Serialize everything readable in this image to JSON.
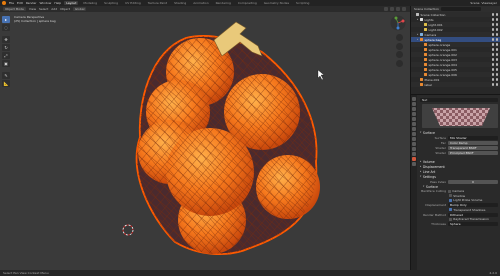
{
  "topbar": {
    "menus": [
      "File",
      "Edit",
      "Render",
      "Window",
      "Help"
    ],
    "workspaces": [
      "Layout",
      "Modeling",
      "Sculpting",
      "UV Editing",
      "Texture Paint",
      "Shading",
      "Animation",
      "Rendering",
      "Compositing",
      "Geometry Nodes",
      "Scripting"
    ],
    "active_workspace": "Layout",
    "scene": "Scene",
    "view_layer": "ViewLayer"
  },
  "viewport_header": {
    "mode": "Object Mode",
    "menus": [
      "View",
      "Select",
      "Add",
      "Object"
    ],
    "transform": "Global"
  },
  "viewport": {
    "view_name": "Camera Perspective",
    "collection": "(25) Collection | sphere bag",
    "tools": [
      "▸",
      "◌",
      "✥",
      "↻",
      "⤢",
      "▣",
      "✎",
      "📐"
    ]
  },
  "outliner": {
    "title": "Scene Collection",
    "rows": [
      {
        "label": "Scene Collection",
        "indent": 0,
        "color": "#bdbdbd",
        "tri": ""
      },
      {
        "label": "Lights",
        "indent": 1,
        "color": "#e0e0e0",
        "tri": "▸"
      },
      {
        "label": "Light.001",
        "indent": 2,
        "color": "#e0c04a",
        "tri": ""
      },
      {
        "label": "Light.002",
        "indent": 2,
        "color": "#e0c04a",
        "tri": ""
      },
      {
        "label": "Camera",
        "indent": 1,
        "color": "#7fb0e0",
        "tri": "▸"
      },
      {
        "label": "sphere bag",
        "indent": 1,
        "color": "#e98a32",
        "tri": "▸",
        "selected": true
      },
      {
        "label": "sphere orange",
        "indent": 2,
        "color": "#e98a32",
        "tri": ""
      },
      {
        "label": "sphere orange.001",
        "indent": 2,
        "color": "#e98a32",
        "tri": ""
      },
      {
        "label": "sphere orange.002",
        "indent": 2,
        "color": "#e98a32",
        "tri": ""
      },
      {
        "label": "sphere orange.003",
        "indent": 2,
        "color": "#e98a32",
        "tri": ""
      },
      {
        "label": "sphere orange.004",
        "indent": 2,
        "color": "#e98a32",
        "tri": ""
      },
      {
        "label": "sphere orange.005",
        "indent": 2,
        "color": "#e98a32",
        "tri": ""
      },
      {
        "label": "sphere orange.006",
        "indent": 2,
        "color": "#e98a32",
        "tri": ""
      },
      {
        "label": "Plane.001",
        "indent": 1,
        "color": "#e98a32",
        "tri": ""
      },
      {
        "label": "label",
        "indent": 1,
        "color": "#e98a32",
        "tri": ""
      }
    ]
  },
  "properties": {
    "material_name": "Net",
    "surface_header": "Surface",
    "rows": [
      {
        "label": "Surface",
        "value": "Mix Shader",
        "style": "dark"
      },
      {
        "label": "Fac",
        "value": "Color Ramp",
        "style": "normal"
      },
      {
        "label": "Shader",
        "value": "Transparent BSDF",
        "style": "normal"
      },
      {
        "label": "Shader",
        "value": "Principled BSDF",
        "style": "normal"
      }
    ],
    "sections": [
      "Volume",
      "Displacement",
      "Line Art",
      "Settings"
    ],
    "pass_index_label": "Pass Index",
    "pass_index_value": "0",
    "surface_sub": "Surface",
    "backface_label": "Backface Culling",
    "checks": [
      {
        "label": "Camera",
        "on": false
      },
      {
        "label": "Shadow",
        "on": false
      },
      {
        "label": "Light Probe Volume",
        "on": true
      }
    ],
    "displacement_label": "Displacement",
    "displacement_value": "Bump Only",
    "transparent_shadows": "Transparent Shadows",
    "render_method_label": "Render Method",
    "render_method_value": "Dithered",
    "raytraced_transmission": "Raytraced Transmission",
    "thickness_label": "Thickness",
    "thickness_value": "Sphere"
  },
  "statusbar": {
    "left": "Select   Pan View   Context Menu",
    "right": "4.2.0"
  },
  "colors": {
    "accent": "#4772b3",
    "orange": "#f2761c",
    "bag_outline": "#ff5a00"
  }
}
